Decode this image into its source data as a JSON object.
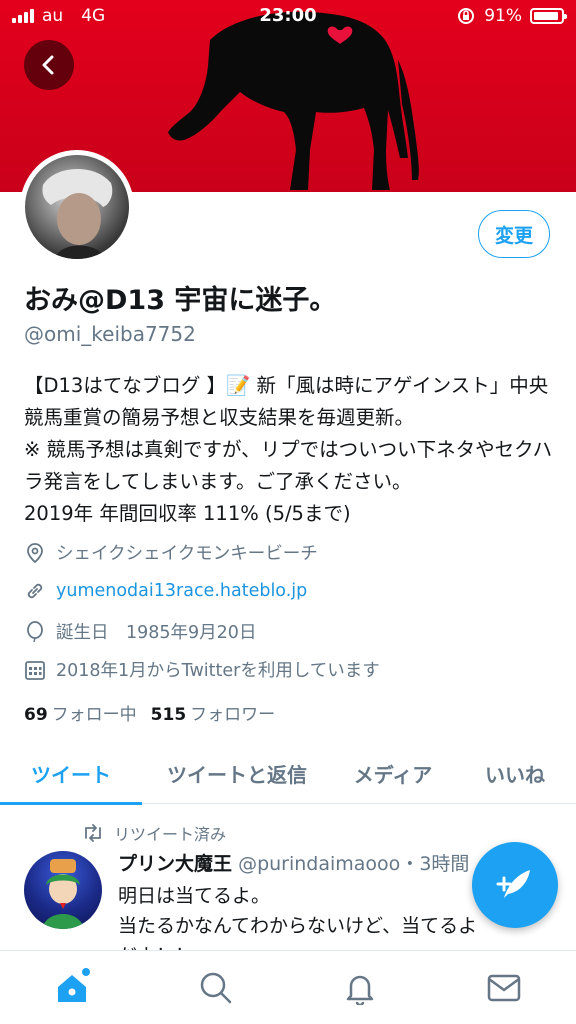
{
  "status_bar": {
    "carrier": "au",
    "network": "4G",
    "time": "23:00",
    "battery": "91%",
    "battery_level": 0.91
  },
  "profile": {
    "edit_label": "変更",
    "display_name": "おみ@D13 宇宙に迷子。",
    "handle": "@omi_keiba7752",
    "bio": "【D13はてなブログ 】📝 新「風は時にアゲインスト」中央競馬重賞の簡易予想と収支結果を毎週更新。\n※ 競馬予想は真剣ですが、リプではついつい下ネタやセクハラ発言をしてしまいます。ご了承ください。\n2019年 年間回収率 111% (5/5まで)",
    "location": "シェイクシェイクモンキービーチ",
    "website": "yumenodai13race.hateblo.jp",
    "birthday": "誕生日　1985年9月20日",
    "joined": "2018年1月からTwitterを利用しています",
    "following_count": "69",
    "following_label": "フォロー中",
    "followers_count": "515",
    "followers_label": "フォロワー"
  },
  "tabs": [
    {
      "label": "ツイート",
      "active": true
    },
    {
      "label": "ツイートと返信",
      "active": false
    },
    {
      "label": "メディア",
      "active": false
    },
    {
      "label": "いいね",
      "active": false
    }
  ],
  "tweet": {
    "retweet_label": "リツイート済み",
    "author_name": "プリン大魔王",
    "author_handle": "@purindaimaooo",
    "time": "・3時間",
    "text": "明日は当てるよ。\n当たるかなんてわからないけど、当てるよ\nだよ！！"
  },
  "colors": {
    "accent": "#1da1f2",
    "banner": "#e3001c",
    "muted": "#657786"
  },
  "icons": {
    "back": "chevron-left-icon",
    "location": "location-pin-icon",
    "link": "link-icon",
    "birthday": "balloon-icon",
    "joined": "calendar-icon",
    "retweet": "retweet-icon",
    "compose": "compose-tweet-icon",
    "home": "home-icon",
    "search": "search-icon",
    "notifications": "bell-icon",
    "messages": "mail-icon"
  }
}
